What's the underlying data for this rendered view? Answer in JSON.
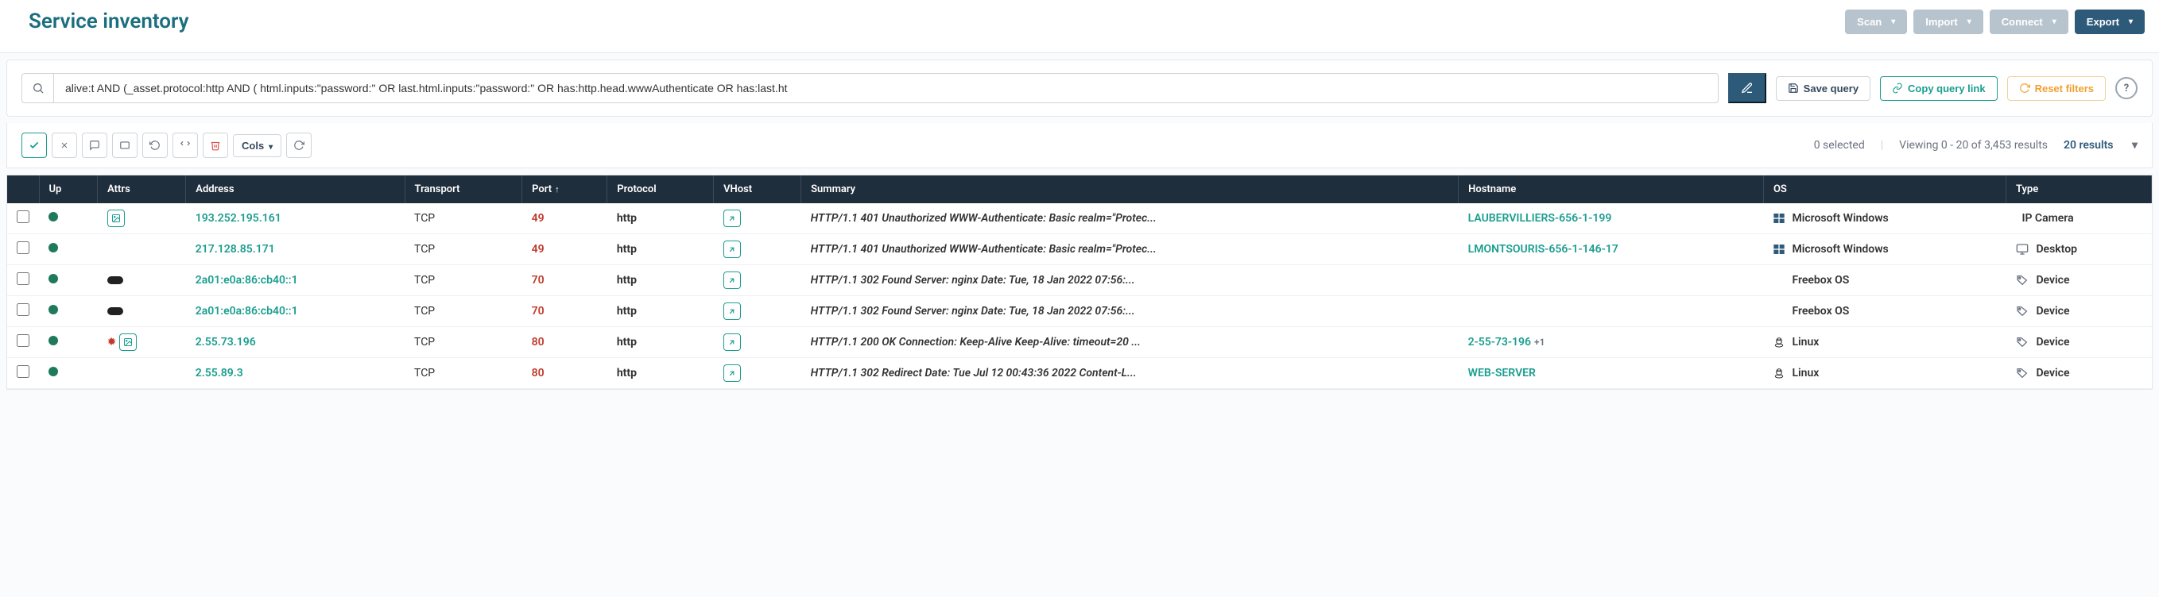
{
  "page": {
    "title": "Service inventory"
  },
  "header": {
    "scan": "Scan",
    "import": "Import",
    "connect": "Connect",
    "export": "Export"
  },
  "search": {
    "value": "alive:t AND (_asset.protocol:http AND ( html.inputs:\"password:\" OR last.html.inputs:\"password:\" OR has:http.head.wwwAuthenticate OR has:last.ht",
    "save_query": "Save query",
    "copy_link": "Copy query link",
    "reset_filters": "Reset filters",
    "help": "?"
  },
  "toolbar": {
    "cols": "Cols",
    "selected": "0 selected",
    "viewing": "Viewing 0 - 20 of 3,453 results",
    "results": "20 results"
  },
  "columns": {
    "up": "Up",
    "attrs": "Attrs",
    "address": "Address",
    "transport": "Transport",
    "port": "Port",
    "protocol": "Protocol",
    "vhost": "VHost",
    "summary": "Summary",
    "hostname": "Hostname",
    "os": "OS",
    "type": "Type"
  },
  "rows": [
    {
      "attrs": [
        "img"
      ],
      "address": "193.252.195.161",
      "transport": "TCP",
      "port": "49",
      "protocol": "http",
      "summary": "HTTP/1.1 401 Unauthorized WWW-Authenticate: Basic realm=\"Protec...",
      "hostname": "LAUBERVILLIERS-656-1-199",
      "host_extra": "",
      "os": "Microsoft Windows",
      "os_icon": "windows",
      "type": "IP Camera",
      "type_icon": "camera"
    },
    {
      "attrs": [],
      "address": "217.128.85.171",
      "transport": "TCP",
      "port": "49",
      "protocol": "http",
      "summary": "HTTP/1.1 401 Unauthorized WWW-Authenticate: Basic realm=\"Protec...",
      "hostname": "LMONTSOURIS-656-1-146-17",
      "host_extra": "",
      "os": "Microsoft Windows",
      "os_icon": "windows",
      "type": "Desktop",
      "type_icon": "desktop"
    },
    {
      "attrs": [
        "pill"
      ],
      "address": "2a01:e0a:86:cb40::1",
      "transport": "TCP",
      "port": "70",
      "protocol": "http",
      "summary": "HTTP/1.1 302 Found Server: nginx Date: Tue, 18 Jan 2022 07:56:...",
      "hostname": "",
      "host_extra": "",
      "os": "Freebox OS",
      "os_icon": "none",
      "type": "Device",
      "type_icon": "tag"
    },
    {
      "attrs": [
        "pill"
      ],
      "address": "2a01:e0a:86:cb40::1",
      "transport": "TCP",
      "port": "70",
      "protocol": "http",
      "summary": "HTTP/1.1 302 Found Server: nginx Date: Tue, 18 Jan 2022 07:56:...",
      "hostname": "",
      "host_extra": "",
      "os": "Freebox OS",
      "os_icon": "none",
      "type": "Device",
      "type_icon": "tag"
    },
    {
      "attrs": [
        "red",
        "img"
      ],
      "address": "2.55.73.196",
      "transport": "TCP",
      "port": "80",
      "protocol": "http",
      "summary": "HTTP/1.1 200 OK Connection: Keep-Alive Keep-Alive: timeout=20 ...",
      "hostname": "2-55-73-196",
      "host_extra": "+1",
      "os": "Linux",
      "os_icon": "linux",
      "type": "Device",
      "type_icon": "tag"
    },
    {
      "attrs": [],
      "address": "2.55.89.3",
      "transport": "TCP",
      "port": "80",
      "protocol": "http",
      "summary": "HTTP/1.1 302 Redirect Date: Tue Jul 12 00:43:36 2022 Content-L...",
      "hostname": "WEB-SERVER",
      "host_extra": "",
      "os": "Linux",
      "os_icon": "linux",
      "type": "Device",
      "type_icon": "tag"
    }
  ]
}
